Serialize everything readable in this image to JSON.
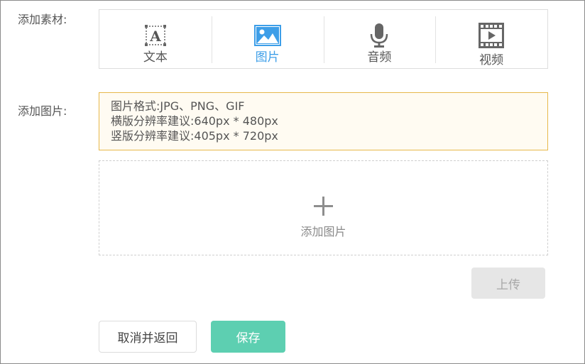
{
  "labels": {
    "add_material": "添加素材:",
    "add_image": "添加图片:"
  },
  "material_tabs": [
    {
      "label": "文本",
      "icon": "text-icon",
      "active": false
    },
    {
      "label": "图片",
      "icon": "image-icon",
      "active": true
    },
    {
      "label": "音频",
      "icon": "microphone-icon",
      "active": false
    },
    {
      "label": "视频",
      "icon": "video-icon",
      "active": false
    }
  ],
  "image_requirements": {
    "format": "图片格式:JPG、PNG、GIF",
    "landscape": "横版分辨率建议:640px * 480px",
    "portrait": "竖版分辨率建议:405px * 720px"
  },
  "dropzone": {
    "label": "添加图片",
    "icon": "plus-icon"
  },
  "buttons": {
    "upload": "上传",
    "cancel": "取消并返回",
    "save": "保存"
  },
  "colors": {
    "active_tab": "#3d9ee8",
    "info_border": "#e7b84a",
    "info_background": "#fffbf2",
    "save_button": "#5dcfb1",
    "upload_disabled": "#e6e6e6"
  }
}
